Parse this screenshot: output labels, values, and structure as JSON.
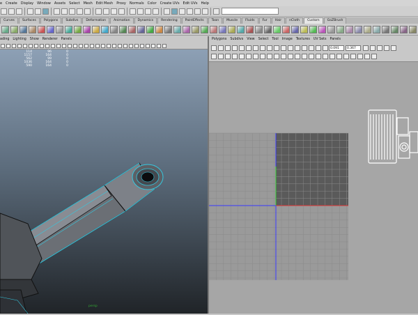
{
  "menubar": [
    "e",
    "Create",
    "Display",
    "Window",
    "Assets",
    "Select",
    "Mesh",
    "Edit Mesh",
    "Proxy",
    "Normals",
    "Color",
    "Create UVs",
    "Edit UVs",
    "Help"
  ],
  "shelf_tabs": [
    "Curves",
    "Surfaces",
    "Polygons",
    "Subdivs",
    "Deformation",
    "Animation",
    "Dynamics",
    "Rendering",
    "PaintEffects",
    "Toon",
    "Muscle",
    "Fluids",
    "Fur",
    "Hair",
    "nCloth",
    "Custom",
    "GoZBrush"
  ],
  "active_tab_index": 15,
  "left_menu": [
    "ading",
    "Lighting",
    "Show",
    "Renderer",
    "Panels"
  ],
  "hud": {
    "rows": [
      [
        "114",
        "96",
        "0"
      ],
      [
        "1157",
        "164",
        "0"
      ],
      [
        "562",
        "99",
        "0"
      ],
      [
        "1036",
        "164",
        "0"
      ],
      [
        "590",
        "164",
        "0"
      ]
    ]
  },
  "right_menu": [
    "Polygons",
    "Subdivs",
    "View",
    "Select",
    "Tool",
    "Image",
    "Textures",
    "UV Sets",
    "Panels"
  ],
  "uv_fields": {
    "u": "0.091",
    "v": "0.367"
  },
  "viewport_label": "persp",
  "colors": {
    "accent": "#35c8e0",
    "uv_axis_red": "#d33",
    "uv_axis_green": "#3c3",
    "uv_axis_blue": "#44f"
  }
}
